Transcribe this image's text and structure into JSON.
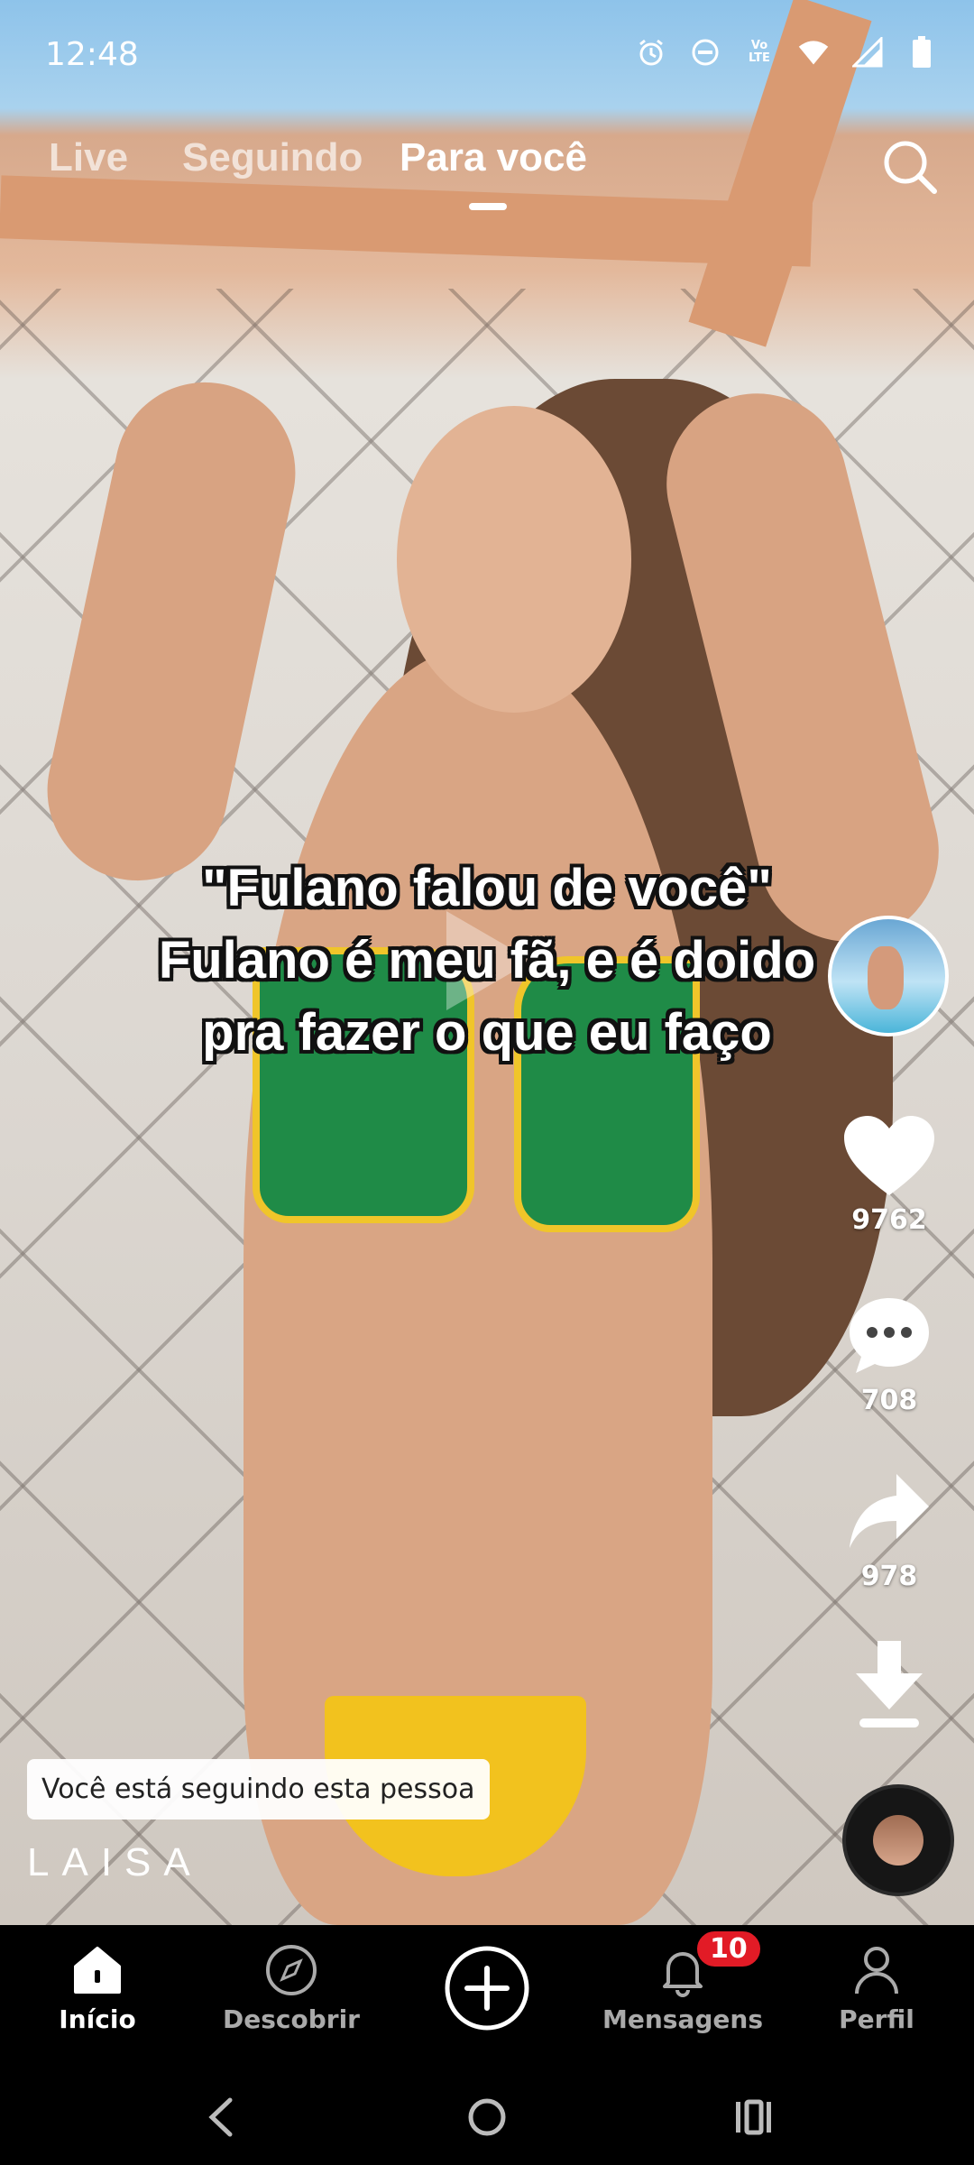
{
  "status_bar": {
    "time": "12:48",
    "icons": [
      "alarm-icon",
      "do-not-disturb-icon",
      "volte-icon",
      "wifi-icon",
      "signal-icon",
      "battery-icon"
    ],
    "volte_text": "Vo LTE"
  },
  "top_tabs": {
    "items": [
      {
        "label": "Live",
        "active": false
      },
      {
        "label": "Seguindo",
        "active": false
      },
      {
        "label": "Para você",
        "active": true
      }
    ],
    "search_icon": "search-icon"
  },
  "video": {
    "caption_lines": [
      "\"Fulano falou de você\"",
      "Fulano é meu fã, e é doido",
      "pra fazer o que eu faço"
    ],
    "follow_toast": "Você está seguindo esta pessoa",
    "watermark": "LAISA"
  },
  "actions": {
    "likes": "9762",
    "comments": "708",
    "shares": "978"
  },
  "bottom_nav": {
    "items": [
      {
        "label": "Início",
        "icon": "home-icon",
        "active": true
      },
      {
        "label": "Descobrir",
        "icon": "compass-icon",
        "active": false
      },
      {
        "label": "",
        "icon": "plus-circle-icon",
        "active": false
      },
      {
        "label": "Mensagens",
        "icon": "bell-icon",
        "active": false
      },
      {
        "label": "Perfil",
        "icon": "person-icon",
        "active": false
      }
    ],
    "messages_badge": "10"
  },
  "colors": {
    "badge": "#e21b26",
    "background": "#000000"
  }
}
